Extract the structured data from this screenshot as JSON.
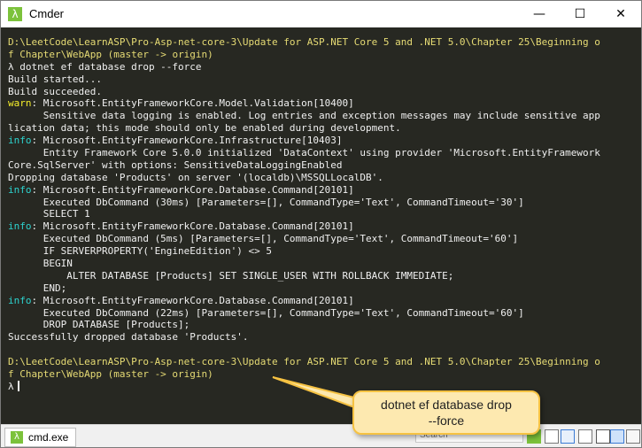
{
  "window": {
    "title": "Cmder",
    "app_icon_glyph": "λ",
    "minimize_glyph": "—",
    "maximize_glyph": "☐",
    "close_glyph": "✕"
  },
  "terminal": {
    "lines": [
      {
        "text": "D:\\LeetCode\\LearnASP\\Pro-Asp-net-core-3\\Update for ASP.NET Core 5 and .NET 5.0\\Chapter 25\\Beginning o",
        "segments": [
          {
            "t": "D:\\LeetCode\\LearnASP\\Pro-Asp-net-core-3\\Update for ASP.NET Core 5 and .NET 5.0\\Chapter 25\\Beginning o",
            "c": "yellow"
          }
        ]
      },
      {
        "segments": [
          {
            "t": "f Chapter\\WebApp ",
            "c": "yellow"
          },
          {
            "t": "(master -> origin)",
            "c": "yellow"
          }
        ]
      },
      {
        "segments": [
          {
            "t": "λ dotnet ef database drop --force",
            "c": "white"
          }
        ]
      },
      {
        "segments": [
          {
            "t": "Build started...",
            "c": "white"
          }
        ]
      },
      {
        "segments": [
          {
            "t": "Build succeeded.",
            "c": "white"
          }
        ]
      },
      {
        "segments": [
          {
            "t": "warn",
            "c": "warn"
          },
          {
            "t": ": Microsoft.EntityFrameworkCore.Model.Validation[10400]",
            "c": "white"
          }
        ]
      },
      {
        "segments": [
          {
            "t": "      Sensitive data logging is enabled. Log entries and exception messages may include sensitive app",
            "c": "white"
          }
        ]
      },
      {
        "segments": [
          {
            "t": "lication data; this mode should only be enabled during development.",
            "c": "white"
          }
        ]
      },
      {
        "segments": [
          {
            "t": "info",
            "c": "cyan"
          },
          {
            "t": ": Microsoft.EntityFrameworkCore.Infrastructure[10403]",
            "c": "white"
          }
        ]
      },
      {
        "segments": [
          {
            "t": "      Entity Framework Core 5.0.0 initialized 'DataContext' using provider 'Microsoft.EntityFramework",
            "c": "white"
          }
        ]
      },
      {
        "segments": [
          {
            "t": "Core.SqlServer' with options: SensitiveDataLoggingEnabled",
            "c": "white"
          }
        ]
      },
      {
        "segments": [
          {
            "t": "Dropping database 'Products' on server '(localdb)\\MSSQLLocalDB'.",
            "c": "white"
          }
        ]
      },
      {
        "segments": [
          {
            "t": "info",
            "c": "cyan"
          },
          {
            "t": ": Microsoft.EntityFrameworkCore.Database.Command[20101]",
            "c": "white"
          }
        ]
      },
      {
        "segments": [
          {
            "t": "      Executed DbCommand (30ms) [Parameters=[], CommandType='Text', CommandTimeout='30']",
            "c": "white"
          }
        ]
      },
      {
        "segments": [
          {
            "t": "      SELECT 1",
            "c": "white"
          }
        ]
      },
      {
        "segments": [
          {
            "t": "info",
            "c": "cyan"
          },
          {
            "t": ": Microsoft.EntityFrameworkCore.Database.Command[20101]",
            "c": "white"
          }
        ]
      },
      {
        "segments": [
          {
            "t": "      Executed DbCommand (5ms) [Parameters=[], CommandType='Text', CommandTimeout='60']",
            "c": "white"
          }
        ]
      },
      {
        "segments": [
          {
            "t": "      IF SERVERPROPERTY('EngineEdition') <> 5",
            "c": "white"
          }
        ]
      },
      {
        "segments": [
          {
            "t": "      BEGIN",
            "c": "white"
          }
        ]
      },
      {
        "segments": [
          {
            "t": "          ALTER DATABASE [Products] SET SINGLE_USER WITH ROLLBACK IMMEDIATE;",
            "c": "white"
          }
        ]
      },
      {
        "segments": [
          {
            "t": "      END;",
            "c": "white"
          }
        ]
      },
      {
        "segments": [
          {
            "t": "info",
            "c": "cyan"
          },
          {
            "t": ": Microsoft.EntityFrameworkCore.Database.Command[20101]",
            "c": "white"
          }
        ]
      },
      {
        "segments": [
          {
            "t": "      Executed DbCommand (22ms) [Parameters=[], CommandType='Text', CommandTimeout='60']",
            "c": "white"
          }
        ]
      },
      {
        "segments": [
          {
            "t": "      DROP DATABASE [Products];",
            "c": "white"
          }
        ]
      },
      {
        "segments": [
          {
            "t": "Successfully dropped database 'Products'.",
            "c": "white"
          }
        ]
      },
      {
        "segments": [
          {
            "t": "",
            "c": "white"
          }
        ]
      },
      {
        "segments": [
          {
            "t": "D:\\LeetCode\\LearnASP\\Pro-Asp-net-core-3\\Update for ASP.NET Core 5 and .NET 5.0\\Chapter 25\\Beginning o",
            "c": "yellow"
          }
        ]
      },
      {
        "segments": [
          {
            "t": "f Chapter\\WebApp (master -> origin)",
            "c": "yellow"
          }
        ]
      },
      {
        "segments": [
          {
            "t": "λ",
            "c": "white"
          }
        ],
        "cursor": true
      }
    ],
    "colors": {
      "background": "#272822",
      "white": "#f0f0f0",
      "yellow": "#e6db74",
      "cyan": "#2dd2ce",
      "warn": "#f5ee2b"
    }
  },
  "statusbar": {
    "tab_label": "cmd.exe",
    "tab_icon_glyph": "λ",
    "search_placeholder": "Search"
  },
  "callout": {
    "line1": "dotnet ef database drop",
    "line2": "--force"
  }
}
